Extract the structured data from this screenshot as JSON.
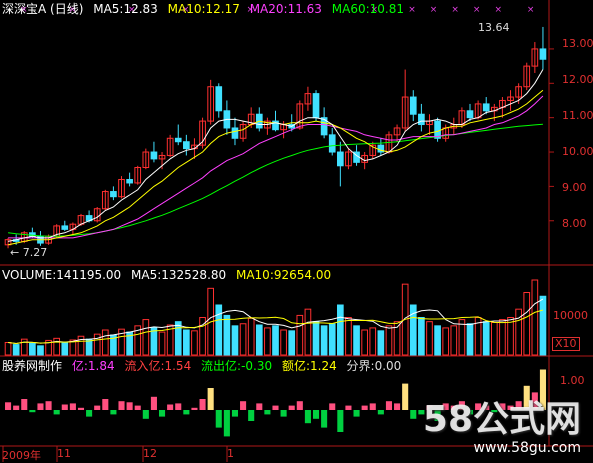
{
  "price_panel": {
    "title": "深深宝A (日线)",
    "ma5_label": "MA5:12.83",
    "ma10_label": "MA10:12.17",
    "ma20_label": "MA20:11.63",
    "ma60_label": "MA60:10.81",
    "high_label": "13.64",
    "low_label": "← 7.27",
    "y_ticks": [
      "13.00",
      "12.00",
      "11.00",
      "10.00",
      "9.00",
      "8.00"
    ],
    "colors": {
      "title": "#ffffff",
      "ma5": "#ffffff",
      "ma10": "#ffff00",
      "ma20": "#ff40ff",
      "ma60": "#00ff00"
    }
  },
  "volume_panel": {
    "volume_label": "VOLUME:141195.00",
    "ma5_label": "MA5:132528.80",
    "ma10_label": "MA10:92654.00",
    "y_tick": "10000",
    "multiplier": "X10"
  },
  "indicator_panel": {
    "title": "股养网制作",
    "yi_label": "亿:1.84",
    "inflow_label": "流入亿:1.54",
    "outflow_label": "流出亿:-0.30",
    "amount_label": "额亿:1.24",
    "boundary_label": "分界:0.00",
    "y_tick": "1.00"
  },
  "x_axis": {
    "labels": [
      "2009年",
      "11",
      "12",
      "1"
    ]
  },
  "watermark": {
    "brand": "58公式网",
    "url": "www.58gu.com"
  },
  "chart_data": {
    "type": "candlestick",
    "y_range": [
      6.8,
      13.9
    ],
    "candles": [
      [
        7.3,
        7.5,
        7.2,
        7.45
      ],
      [
        7.45,
        7.6,
        7.3,
        7.4
      ],
      [
        7.4,
        7.7,
        7.35,
        7.65
      ],
      [
        7.65,
        7.8,
        7.5,
        7.55
      ],
      [
        7.55,
        7.7,
        7.27,
        7.35
      ],
      [
        7.35,
        7.6,
        7.3,
        7.55
      ],
      [
        7.55,
        7.9,
        7.5,
        7.85
      ],
      [
        7.85,
        8.0,
        7.7,
        7.75
      ],
      [
        7.75,
        7.95,
        7.6,
        7.9
      ],
      [
        7.9,
        8.2,
        7.85,
        8.15
      ],
      [
        8.15,
        8.3,
        7.95,
        8.0
      ],
      [
        8.0,
        8.4,
        7.95,
        8.35
      ],
      [
        8.35,
        8.9,
        8.3,
        8.85
      ],
      [
        8.85,
        9.0,
        8.6,
        8.7
      ],
      [
        8.7,
        9.3,
        8.65,
        9.2
      ],
      [
        9.2,
        9.4,
        9.0,
        9.1
      ],
      [
        9.1,
        9.6,
        9.05,
        9.55
      ],
      [
        9.55,
        10.1,
        9.5,
        10.0
      ],
      [
        10.0,
        10.3,
        9.7,
        9.8
      ],
      [
        9.8,
        10.0,
        9.5,
        9.9
      ],
      [
        9.9,
        10.5,
        9.85,
        10.4
      ],
      [
        10.4,
        10.8,
        10.2,
        10.3
      ],
      [
        10.3,
        10.5,
        9.9,
        10.1
      ],
      [
        10.1,
        10.4,
        9.8,
        10.2
      ],
      [
        10.2,
        11.0,
        10.1,
        10.9
      ],
      [
        10.9,
        12.1,
        10.8,
        11.9
      ],
      [
        11.9,
        12.0,
        11.0,
        11.2
      ],
      [
        11.2,
        11.5,
        10.5,
        10.7
      ],
      [
        10.7,
        11.0,
        10.2,
        10.4
      ],
      [
        10.4,
        10.9,
        10.3,
        10.8
      ],
      [
        10.8,
        11.3,
        10.7,
        11.1
      ],
      [
        11.1,
        11.3,
        10.6,
        10.7
      ],
      [
        10.7,
        11.0,
        10.5,
        10.9
      ],
      [
        10.9,
        11.2,
        10.6,
        10.65
      ],
      [
        10.65,
        10.9,
        10.4,
        10.8
      ],
      [
        10.8,
        11.1,
        10.6,
        10.7
      ],
      [
        10.7,
        11.5,
        10.65,
        11.4
      ],
      [
        11.4,
        11.9,
        11.2,
        11.7
      ],
      [
        11.7,
        11.8,
        10.9,
        11.0
      ],
      [
        11.0,
        11.3,
        10.4,
        10.5
      ],
      [
        10.5,
        10.7,
        9.9,
        10.0
      ],
      [
        10.0,
        10.3,
        9.0,
        9.6
      ],
      [
        9.6,
        10.1,
        9.5,
        10.0
      ],
      [
        10.0,
        10.2,
        9.6,
        9.7
      ],
      [
        9.7,
        10.0,
        9.5,
        9.9
      ],
      [
        9.9,
        10.3,
        9.8,
        10.2
      ],
      [
        10.2,
        10.4,
        9.9,
        10.0
      ],
      [
        10.0,
        10.6,
        9.95,
        10.5
      ],
      [
        10.5,
        10.8,
        10.3,
        10.7
      ],
      [
        10.7,
        12.4,
        10.6,
        11.6
      ],
      [
        11.6,
        11.8,
        10.9,
        11.1
      ],
      [
        11.1,
        11.4,
        10.6,
        10.8
      ],
      [
        10.8,
        11.1,
        10.5,
        10.9
      ],
      [
        10.9,
        11.0,
        10.3,
        10.4
      ],
      [
        10.4,
        10.8,
        10.3,
        10.7
      ],
      [
        10.7,
        11.0,
        10.5,
        10.8
      ],
      [
        10.8,
        11.3,
        10.7,
        11.2
      ],
      [
        11.2,
        11.4,
        10.9,
        11.0
      ],
      [
        11.0,
        11.5,
        10.95,
        11.4
      ],
      [
        11.4,
        11.6,
        11.1,
        11.2
      ],
      [
        11.2,
        11.4,
        10.9,
        11.3
      ],
      [
        11.3,
        11.6,
        11.0,
        11.5
      ],
      [
        11.5,
        11.8,
        11.2,
        11.6
      ],
      [
        11.6,
        12.0,
        11.4,
        11.9
      ],
      [
        11.9,
        12.6,
        11.8,
        12.5
      ],
      [
        12.5,
        13.2,
        12.3,
        13.0
      ],
      [
        13.0,
        13.64,
        12.4,
        12.7
      ]
    ],
    "ma5": [
      7.4,
      7.45,
      7.5,
      7.55,
      7.5,
      7.5,
      7.6,
      7.65,
      7.75,
      7.9,
      8.0,
      8.1,
      8.3,
      8.4,
      8.6,
      8.75,
      8.9,
      9.2,
      9.4,
      9.6,
      9.8,
      9.95,
      10.05,
      10.1,
      10.3,
      10.7,
      10.9,
      10.95,
      10.95,
      10.9,
      10.85,
      10.8,
      10.8,
      10.85,
      10.8,
      10.75,
      10.9,
      11.0,
      11.0,
      10.95,
      10.8,
      10.45,
      10.1,
      9.9,
      9.75,
      9.8,
      9.9,
      10.0,
      10.2,
      10.6,
      10.8,
      10.9,
      10.9,
      10.95,
      10.9,
      10.8,
      10.8,
      10.95,
      11.0,
      11.15,
      11.2,
      11.3,
      11.4,
      11.5,
      11.7,
      12.0,
      12.4
    ],
    "ma10": [
      7.3,
      7.35,
      7.4,
      7.45,
      7.45,
      7.45,
      7.5,
      7.55,
      7.6,
      7.65,
      7.75,
      7.85,
      8.0,
      8.1,
      8.25,
      8.4,
      8.6,
      8.8,
      9.0,
      9.15,
      9.35,
      9.55,
      9.7,
      9.85,
      10.0,
      10.25,
      10.45,
      10.55,
      10.6,
      10.65,
      10.8,
      10.9,
      10.85,
      10.85,
      10.8,
      10.85,
      10.85,
      10.85,
      10.9,
      10.85,
      10.8,
      10.7,
      10.55,
      10.4,
      10.3,
      10.15,
      10.05,
      10.0,
      10.05,
      10.15,
      10.3,
      10.45,
      10.55,
      10.6,
      10.7,
      10.75,
      10.75,
      10.85,
      10.9,
      10.95,
      11.0,
      11.05,
      11.15,
      11.25,
      11.4,
      11.6,
      11.8
    ],
    "ma20": [
      7.5,
      7.5,
      7.5,
      7.5,
      7.5,
      7.5,
      7.5,
      7.5,
      7.5,
      7.55,
      7.6,
      7.65,
      7.7,
      7.75,
      7.85,
      7.95,
      8.05,
      8.2,
      8.35,
      8.5,
      8.65,
      8.8,
      8.95,
      9.1,
      9.25,
      9.45,
      9.6,
      9.75,
      9.85,
      9.95,
      10.1,
      10.25,
      10.35,
      10.45,
      10.55,
      10.65,
      10.75,
      10.8,
      10.8,
      10.8,
      10.75,
      10.7,
      10.65,
      10.6,
      10.5,
      10.45,
      10.4,
      10.35,
      10.35,
      10.4,
      10.45,
      10.45,
      10.45,
      10.45,
      10.5,
      10.5,
      10.55,
      10.6,
      10.65,
      10.7,
      10.8,
      10.85,
      10.95,
      11.05,
      11.2,
      11.4,
      11.63
    ],
    "ma60": [
      7.65,
      7.62,
      7.6,
      7.58,
      7.56,
      7.55,
      7.55,
      7.56,
      7.58,
      7.6,
      7.62,
      7.65,
      7.7,
      7.75,
      7.8,
      7.86,
      7.93,
      8.0,
      8.08,
      8.16,
      8.25,
      8.35,
      8.45,
      8.55,
      8.65,
      8.77,
      8.9,
      9.02,
      9.15,
      9.27,
      9.4,
      9.52,
      9.63,
      9.73,
      9.82,
      9.9,
      9.98,
      10.05,
      10.1,
      10.15,
      10.18,
      10.2,
      10.22,
      10.23,
      10.24,
      10.25,
      10.26,
      10.28,
      10.3,
      10.33,
      10.36,
      10.39,
      10.42,
      10.45,
      10.48,
      10.51,
      10.54,
      10.57,
      10.6,
      10.63,
      10.66,
      10.69,
      10.72,
      10.75,
      10.77,
      10.79,
      10.81
    ],
    "volume": [
      30,
      25,
      38,
      28,
      22,
      35,
      40,
      30,
      36,
      45,
      38,
      50,
      60,
      48,
      62,
      55,
      70,
      85,
      65,
      55,
      72,
      80,
      60,
      58,
      90,
      160,
      120,
      95,
      70,
      75,
      88,
      72,
      65,
      70,
      60,
      58,
      95,
      110,
      80,
      70,
      75,
      120,
      90,
      70,
      60,
      65,
      58,
      70,
      80,
      170,
      120,
      90,
      80,
      70,
      65,
      70,
      85,
      75,
      90,
      80,
      78,
      85,
      90,
      110,
      150,
      180,
      141
    ],
    "money_flow": [
      0.35,
      0.2,
      0.5,
      -0.1,
      0.3,
      0.4,
      -0.2,
      0.25,
      0.3,
      0.1,
      -0.3,
      0.2,
      0.5,
      -0.2,
      0.4,
      0.35,
      0.2,
      -0.4,
      0.6,
      -0.3,
      0.25,
      0.3,
      -0.2,
      0.1,
      0.5,
      1.0,
      -0.8,
      -1.2,
      -0.3,
      0.4,
      -0.5,
      0.3,
      -0.2,
      0.2,
      -0.3,
      0.2,
      0.4,
      -0.6,
      -0.4,
      -0.8,
      0.3,
      -1.0,
      0.2,
      -0.3,
      0.2,
      0.3,
      -0.2,
      0.4,
      0.3,
      1.2,
      -0.4,
      -0.2,
      0.2,
      -0.5,
      0.3,
      0.2,
      0.4,
      -0.2,
      0.3,
      0.2,
      -0.1,
      0.3,
      0.2,
      0.4,
      1.1,
      0.8,
      1.84
    ]
  }
}
